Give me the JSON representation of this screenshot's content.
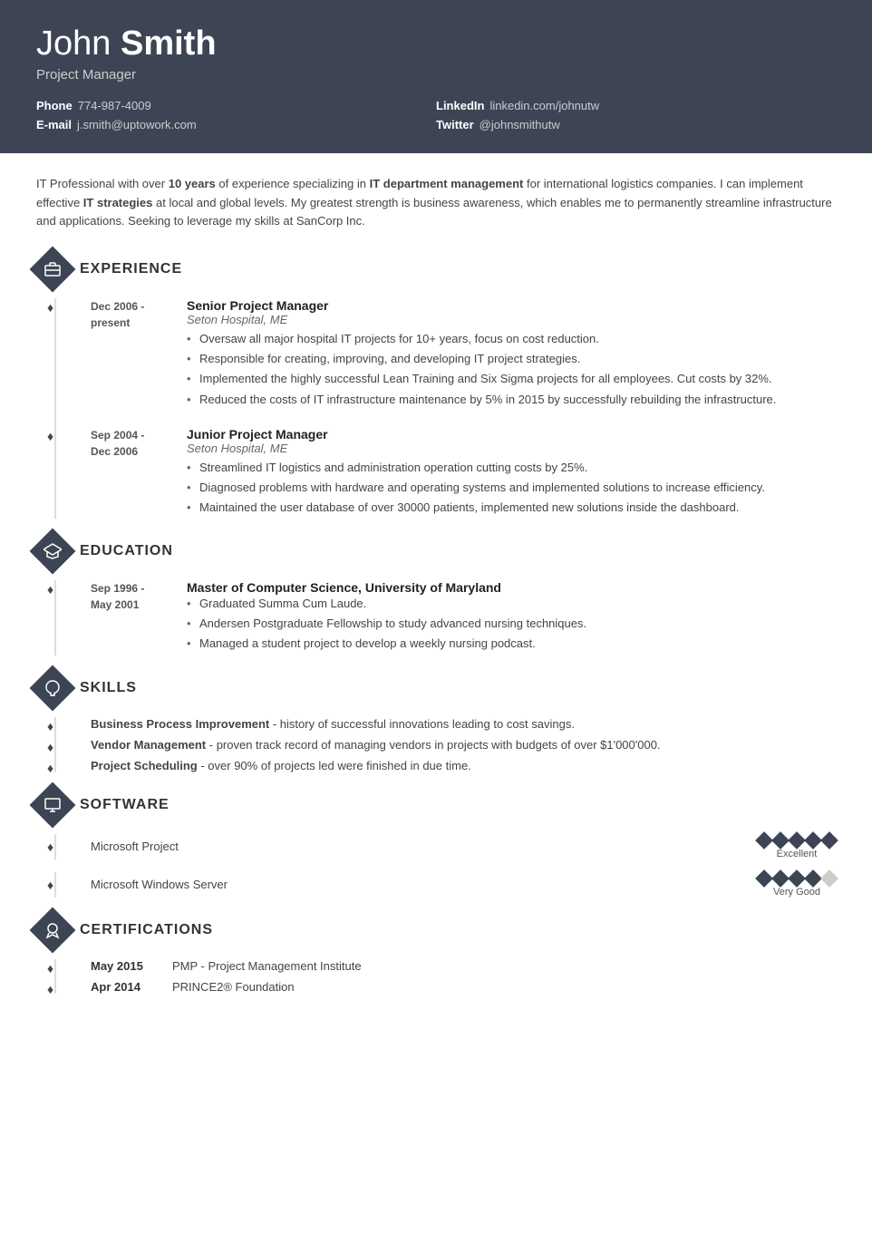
{
  "header": {
    "first_name": "John",
    "last_name": "Smith",
    "title": "Project Manager",
    "contacts": {
      "phone_label": "Phone",
      "phone_value": "774-987-4009",
      "email_label": "E-mail",
      "email_value": "j.smith@uptowork.com",
      "linkedin_label": "LinkedIn",
      "linkedin_value": "linkedin.com/johnutw",
      "twitter_label": "Twitter",
      "twitter_value": "@johnsmithutw"
    }
  },
  "summary": {
    "text_parts": [
      "IT Professional with over ",
      "10 years",
      " of experience specializing in ",
      "IT department management",
      " for international logistics companies. I can implement effective ",
      "IT strategies",
      " at local and global levels. My greatest strength is business awareness, which enables me to permanently streamline infrastructure and applications. Seeking to leverage my skills at SanCorp Inc."
    ]
  },
  "sections": {
    "experience": {
      "title": "EXPERIENCE",
      "items": [
        {
          "date": "Dec 2006 -\npresent",
          "job_title": "Senior Project Manager",
          "company": "Seton Hospital, ME",
          "bullets": [
            "Oversaw all major hospital IT projects for 10+ years, focus on cost reduction.",
            "Responsible for creating, improving, and developing IT project strategies.",
            "Implemented the highly successful Lean Training and Six Sigma projects for all employees. Cut costs by 32%.",
            "Reduced the costs of IT infrastructure maintenance by 5% in 2015 by successfully rebuilding the infrastructure."
          ]
        },
        {
          "date": "Sep 2004 -\nDec 2006",
          "job_title": "Junior Project Manager",
          "company": "Seton Hospital, ME",
          "bullets": [
            "Streamlined IT logistics and administration operation cutting costs by 25%.",
            "Diagnosed problems with hardware and operating systems and implemented solutions to increase efficiency.",
            "Maintained the user database of over 30000 patients, implemented new solutions inside the dashboard."
          ]
        }
      ]
    },
    "education": {
      "title": "EDUCATION",
      "items": [
        {
          "date": "Sep 1996 -\nMay 2001",
          "degree": "Master of Computer Science, University of Maryland",
          "bullets": [
            "Graduated Summa Cum Laude.",
            "Andersen Postgraduate Fellowship to study advanced nursing techniques.",
            "Managed a student project to develop a weekly nursing podcast."
          ]
        }
      ]
    },
    "skills": {
      "title": "SKILLS",
      "items": [
        {
          "name": "Business Process Improvement",
          "description": " - history of successful innovations leading to cost savings."
        },
        {
          "name": "Vendor Management",
          "description": " - proven track record of managing vendors in projects with budgets of over $1'000'000."
        },
        {
          "name": "Project Scheduling",
          "description": " - over 90% of projects led were finished in due time."
        }
      ]
    },
    "software": {
      "title": "SOFTWARE",
      "items": [
        {
          "name": "Microsoft Project",
          "rating": 5,
          "max": 5,
          "label": "Excellent"
        },
        {
          "name": "Microsoft Windows Server",
          "rating": 4,
          "max": 5,
          "label": "Very Good"
        }
      ]
    },
    "certifications": {
      "title": "CERTIFICATIONS",
      "items": [
        {
          "date": "May 2015",
          "name": "PMP - Project Management Institute"
        },
        {
          "date": "Apr 2014",
          "name": "PRINCE2® Foundation"
        }
      ]
    }
  }
}
